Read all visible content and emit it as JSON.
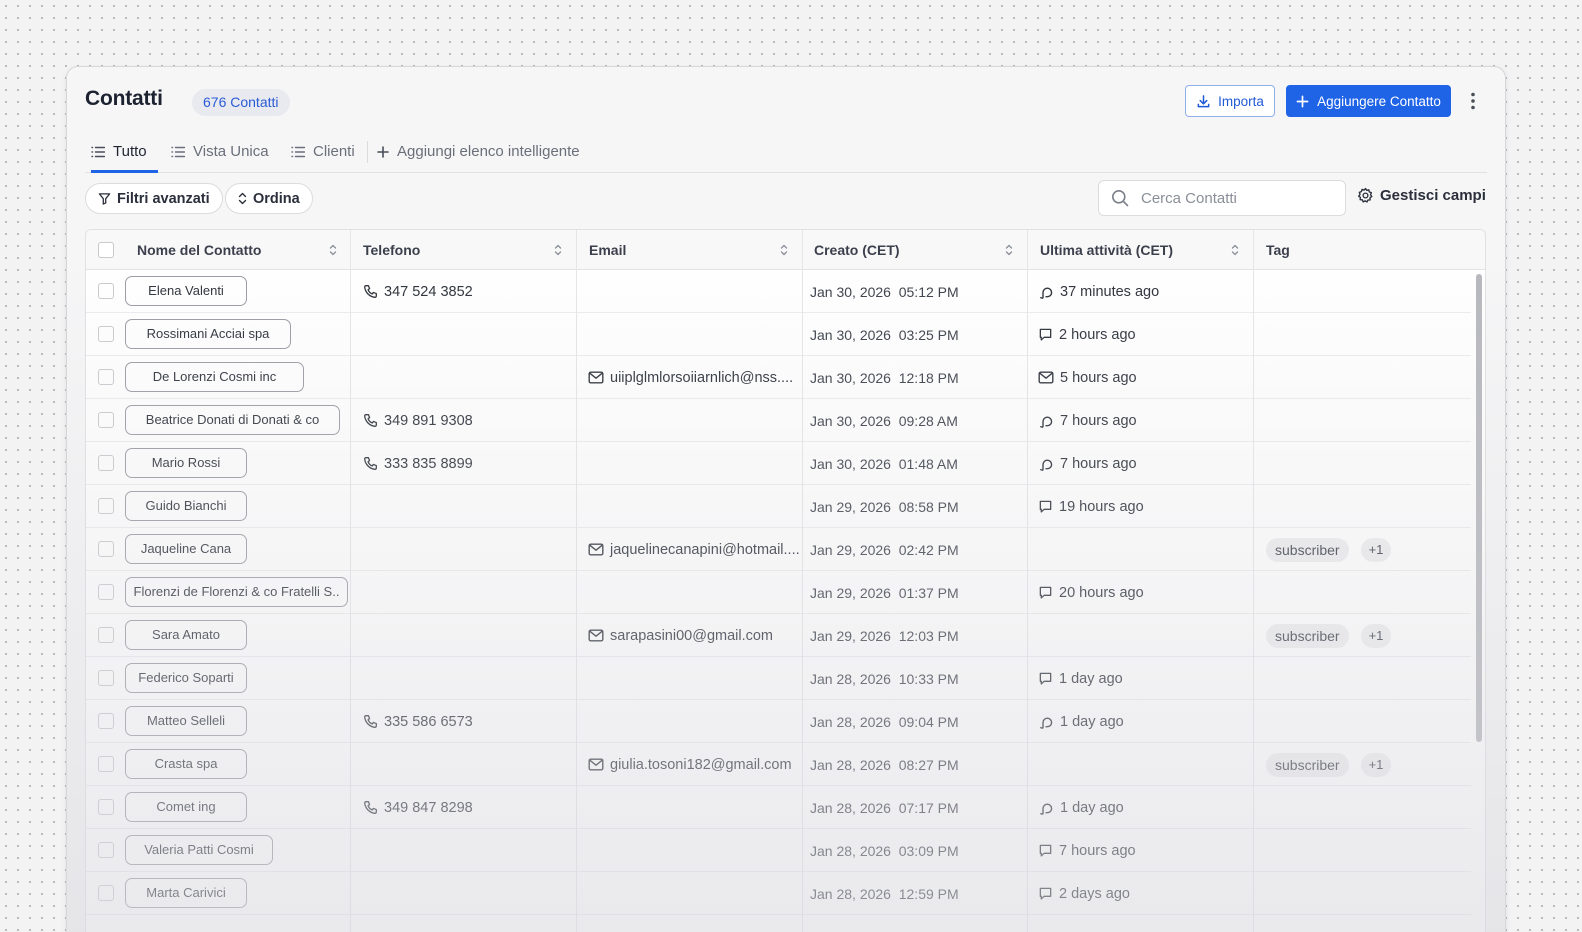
{
  "header": {
    "title": "Contatti",
    "count_badge": "676 Contatti",
    "import_label": "Importa",
    "add_label": "Aggiungere Contatto"
  },
  "tabs": [
    {
      "label": "Tutto",
      "active": true
    },
    {
      "label": "Vista Unica",
      "active": false
    },
    {
      "label": "Clienti",
      "active": false
    },
    {
      "label": "Aggiungi elenco intelligente",
      "active": false
    }
  ],
  "toolbar": {
    "filters_label": "Filtri avanzati",
    "sort_label": "Ordina",
    "search_placeholder": "Cerca Contatti",
    "manage_fields_label": "Gestisci campi"
  },
  "table": {
    "columns": [
      "Nome del Contatto",
      "Telefono",
      "Email",
      "Creato (CET)",
      "Ultima attività (CET)",
      "Tag"
    ],
    "rows": [
      {
        "name": "Elena Valenti",
        "phone": "347 524 3852",
        "email": "",
        "created": "Jan 30, 2026  05:12 PM",
        "activity_icon": "call-icon",
        "activity": "37 minutes ago",
        "tags": []
      },
      {
        "name": "Rossimani Acciai spa",
        "phone": "",
        "email": "",
        "created": "Jan 30, 2026  03:25 PM",
        "activity_icon": "chat-icon",
        "activity": "2 hours ago",
        "tags": []
      },
      {
        "name": "De Lorenzi Cosmi inc",
        "phone": "",
        "email": "uiiplglmlorsoiiarnlich@nss....",
        "created": "Jan 30, 2026  12:18 PM",
        "activity_icon": "mail-icon",
        "activity": "5 hours ago",
        "tags": []
      },
      {
        "name": "Beatrice Donati di Donati & co",
        "phone": "349 891 9308",
        "email": "",
        "created": "Jan 30, 2026  09:28 AM",
        "activity_icon": "call-icon",
        "activity": "7 hours ago",
        "tags": []
      },
      {
        "name": "Mario Rossi",
        "phone": "333 835 8899",
        "email": "",
        "created": "Jan 30, 2026  01:48 AM",
        "activity_icon": "call-icon",
        "activity": "7 hours ago",
        "tags": []
      },
      {
        "name": "Guido Bianchi",
        "phone": "",
        "email": "",
        "created": "Jan 29, 2026  08:58 PM",
        "activity_icon": "chat-icon",
        "activity": "19 hours ago",
        "tags": []
      },
      {
        "name": "Jaqueline Cana",
        "phone": "",
        "email": "jaquelinecanapini@hotmail....",
        "created": "Jan 29, 2026  02:42 PM",
        "activity_icon": "",
        "activity": "",
        "tags": [
          "subscriber",
          "+1"
        ]
      },
      {
        "name": "Florenzi de Florenzi & co Fratelli S..",
        "phone": "",
        "email": "",
        "created": "Jan 29, 2026  01:37 PM",
        "activity_icon": "chat-icon",
        "activity": "20 hours ago",
        "tags": []
      },
      {
        "name": "Sara Amato",
        "phone": "",
        "email": "sarapasini00@gmail.com",
        "created": "Jan 29, 2026  12:03 PM",
        "activity_icon": "",
        "activity": "",
        "tags": [
          "subscriber",
          "+1"
        ]
      },
      {
        "name": "Federico Soparti",
        "phone": "",
        "email": "",
        "created": "Jan 28, 2026  10:33 PM",
        "activity_icon": "chat-icon",
        "activity": "1 day ago",
        "tags": []
      },
      {
        "name": "Matteo Selleli",
        "phone": "335 586 6573",
        "email": "",
        "created": "Jan 28, 2026  09:04 PM",
        "activity_icon": "call-icon",
        "activity": "1 day ago",
        "tags": []
      },
      {
        "name": "Crasta spa",
        "phone": "",
        "email": "giulia.tosoni182@gmail.com",
        "created": "Jan 28, 2026  08:27 PM",
        "activity_icon": "",
        "activity": "",
        "tags": [
          "subscriber",
          "+1"
        ]
      },
      {
        "name": "Comet ing",
        "phone": "349 847 8298",
        "email": "",
        "created": "Jan 28, 2026  07:17 PM",
        "activity_icon": "call-icon",
        "activity": "1 day ago",
        "tags": []
      },
      {
        "name": "Valeria Patti Cosmi",
        "phone": "",
        "email": "",
        "created": "Jan 28, 2026  03:09 PM",
        "activity_icon": "chat-icon",
        "activity": "7 hours ago",
        "tags": []
      },
      {
        "name": "Marta Carivici",
        "phone": "",
        "email": "",
        "created": "Jan 28, 2026  12:59 PM",
        "activity_icon": "chat-icon",
        "activity": "2 days ago",
        "tags": []
      }
    ]
  },
  "colors": {
    "accent": "#1f63e6",
    "badge_text": "#2a5bd7"
  }
}
